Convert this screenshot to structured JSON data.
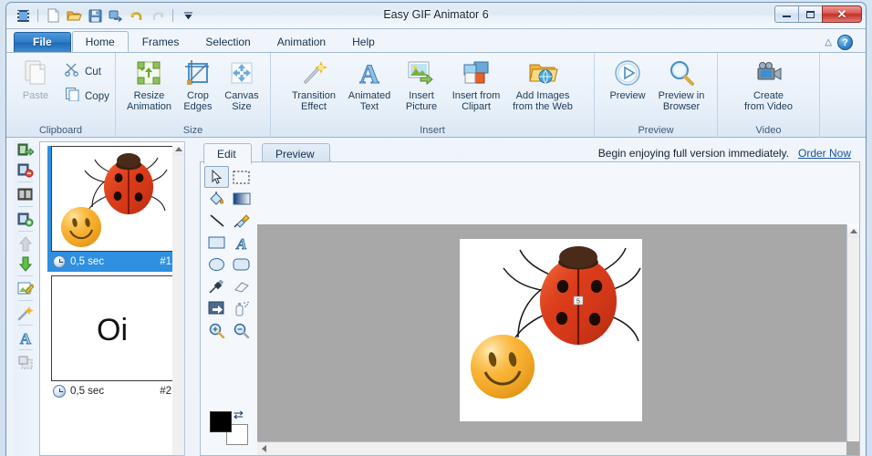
{
  "window": {
    "title": "Easy GIF Animator 6",
    "controls": {
      "minimize": "minimize-button",
      "maximize": "maximize-button",
      "close": "✕"
    }
  },
  "quick_access": {
    "items": [
      {
        "name": "app-icon",
        "icon": "film-strip-icon"
      },
      {
        "name": "new-document",
        "icon": "page-icon"
      },
      {
        "name": "open-file",
        "icon": "folder-open-icon"
      },
      {
        "name": "save-file",
        "icon": "floppy-disk-icon"
      },
      {
        "name": "export",
        "icon": "export-icon"
      },
      {
        "name": "undo",
        "icon": "undo-arrow-icon"
      },
      {
        "name": "redo",
        "icon": "redo-arrow-icon"
      },
      {
        "name": "customize-qat",
        "icon": "chevron-down-icon"
      }
    ]
  },
  "ribbon": {
    "tabs": [
      {
        "label": "File",
        "active": false,
        "style": "file"
      },
      {
        "label": "Home",
        "active": true
      },
      {
        "label": "Frames",
        "active": false
      },
      {
        "label": "Selection",
        "active": false
      },
      {
        "label": "Animation",
        "active": false
      },
      {
        "label": "Help",
        "active": false
      }
    ],
    "help_glyph": "?",
    "collapse_glyph": "△",
    "groups": [
      {
        "label": "Clipboard",
        "big": [
          {
            "label": "Paste",
            "icon": "paste-icon",
            "disabled": true
          }
        ],
        "small": [
          {
            "label": "Cut",
            "icon": "scissors-icon"
          },
          {
            "label": "Copy",
            "icon": "copy-icon"
          }
        ]
      },
      {
        "label": "Size",
        "buttons": [
          {
            "label": "Resize\nAnimation",
            "icon": "resize-animation-icon"
          },
          {
            "label": "Crop\nEdges",
            "icon": "crop-icon"
          },
          {
            "label": "Canvas\nSize",
            "icon": "canvas-size-icon"
          }
        ]
      },
      {
        "label": "Insert",
        "buttons": [
          {
            "label": "Transition\nEffect",
            "icon": "magic-wand-icon"
          },
          {
            "label": "Animated\nText",
            "icon": "letter-a-icon"
          },
          {
            "label": "Insert\nPicture",
            "icon": "insert-picture-icon"
          },
          {
            "label": "Insert from\nClipart",
            "icon": "clipart-icon"
          },
          {
            "label": "Add Images\nfrom the Web",
            "icon": "web-folder-icon"
          }
        ]
      },
      {
        "label": "Preview",
        "buttons": [
          {
            "label": "Preview",
            "icon": "play-circle-icon"
          },
          {
            "label": "Preview in\nBrowser",
            "icon": "magnifier-icon"
          }
        ]
      },
      {
        "label": "Video",
        "buttons": [
          {
            "label": "Create\nfrom Video",
            "icon": "video-camera-icon"
          }
        ]
      }
    ]
  },
  "frame_tools": [
    {
      "name": "insert-frame",
      "icon": "film-arrow-icon"
    },
    {
      "name": "delete-frame",
      "icon": "film-minus-icon"
    },
    {
      "name": "duplicate-frame",
      "icon": "film-copy-icon"
    },
    {
      "name": "add-frame",
      "icon": "film-plus-icon"
    },
    {
      "name": "move-frame-up",
      "icon": "arrow-up-icon",
      "disabled": true
    },
    {
      "name": "move-frame-down",
      "icon": "arrow-down-icon"
    },
    {
      "name": "edit-frame",
      "icon": "edit-frame-icon"
    },
    {
      "name": "magic-wand",
      "icon": "magic-wand-icon"
    },
    {
      "name": "add-text",
      "icon": "letter-a-icon"
    },
    {
      "name": "select-region",
      "icon": "selection-icon"
    }
  ],
  "frames": [
    {
      "duration": "0,5 sec",
      "number": "#1",
      "selected": true,
      "content": "ladybug-and-smiley"
    },
    {
      "duration": "0,5 sec",
      "number": "#2",
      "selected": false,
      "content": "Oi"
    }
  ],
  "editor": {
    "tabs": [
      {
        "label": "Edit",
        "active": true
      },
      {
        "label": "Preview",
        "active": false
      }
    ],
    "promo": {
      "text": "Begin enjoying full version immediately.",
      "link": "Order Now"
    },
    "tool_palette": [
      {
        "name": "pointer-tool",
        "icon": "arrow-cursor-icon",
        "selected": true
      },
      {
        "name": "marquee-select-tool",
        "icon": "dashed-rectangle-icon",
        "selected": false
      },
      {
        "name": "paint-bucket-tool",
        "icon": "paint-bucket-icon",
        "selected": false
      },
      {
        "name": "gradient-tool",
        "icon": "gradient-icon",
        "selected": false
      },
      {
        "name": "line-tool",
        "icon": "line-icon",
        "selected": false
      },
      {
        "name": "brush-tool",
        "icon": "paintbrush-icon",
        "selected": false
      },
      {
        "name": "rectangle-tool",
        "icon": "rectangle-icon",
        "selected": false
      },
      {
        "name": "text-tool",
        "icon": "letter-a-icon",
        "selected": false
      },
      {
        "name": "ellipse-tool",
        "icon": "ellipse-icon",
        "selected": false
      },
      {
        "name": "rounded-rectangle-tool",
        "icon": "rounded-rectangle-icon",
        "selected": false
      },
      {
        "name": "eyedropper-tool",
        "icon": "eyedropper-icon",
        "selected": false
      },
      {
        "name": "eraser-tool",
        "icon": "eraser-icon",
        "selected": false
      },
      {
        "name": "transform-tool",
        "icon": "transform-icon",
        "selected": false
      },
      {
        "name": "spray-tool",
        "icon": "spray-can-icon",
        "selected": false
      },
      {
        "name": "zoom-in-tool",
        "icon": "zoom-in-icon",
        "selected": false
      },
      {
        "name": "zoom-out-tool",
        "icon": "zoom-out-icon",
        "selected": false
      }
    ],
    "colors": {
      "foreground": "#000000",
      "background": "#ffffff",
      "swap_glyph": "⇄"
    },
    "canvas": {
      "background": "#a8a8a8",
      "image_background": "#ffffff",
      "content": "ladybug-and-smiley"
    }
  },
  "theme": {
    "accent": "#2f8fe0",
    "ribbon_bg": "#eaf1f9",
    "title_text": "#112233",
    "link": "#15539e",
    "close_red": "#c32f27"
  }
}
